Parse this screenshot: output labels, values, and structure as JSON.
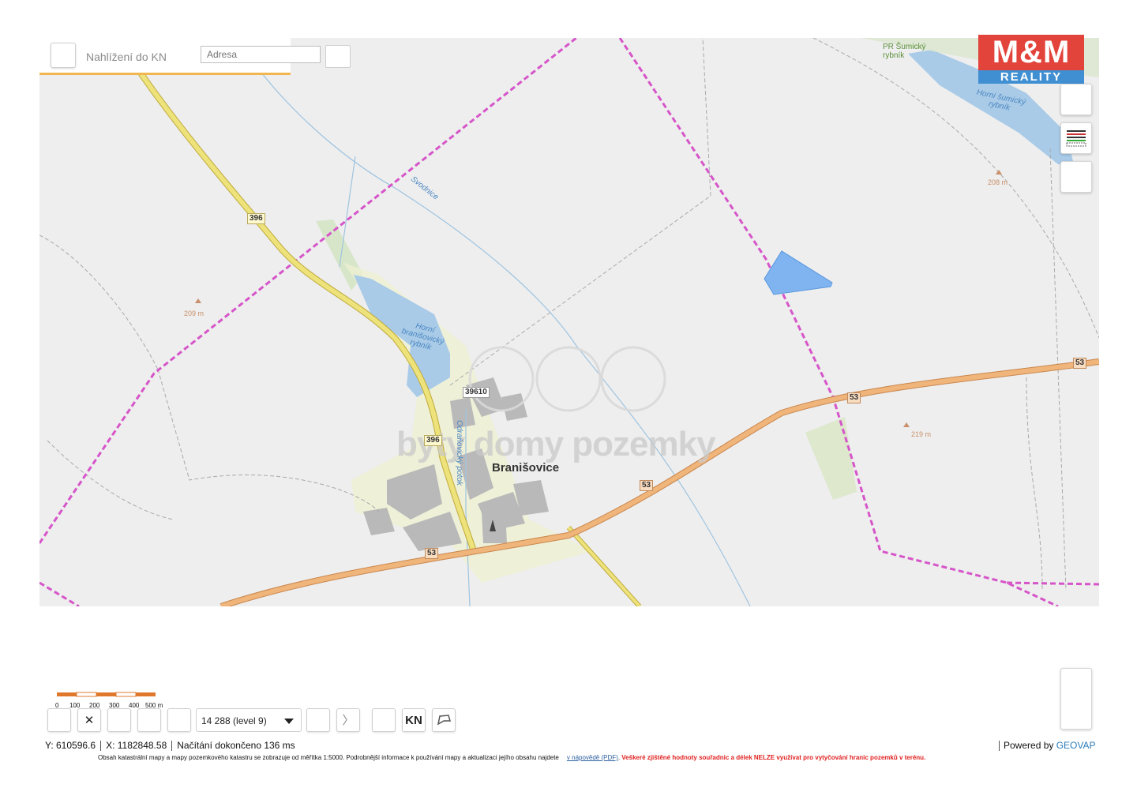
{
  "header": {
    "title": "Nahlížení do KN",
    "address_placeholder": "Adresa"
  },
  "logo": {
    "top": "M&M",
    "bottom": "REALITY"
  },
  "map_labels": {
    "town": "Branišovice",
    "pond_upper_left": [
      "Horní",
      "branišovický",
      "rybník"
    ],
    "pond_upper_right": [
      "Horní šumický",
      "rybník"
    ],
    "reserve": [
      "PR Šumický",
      "rybník"
    ],
    "stream1": "Svodnice",
    "stream2": "Odraňovický potok",
    "elev1": "209 m",
    "elev2": "208 m",
    "elev3": "219 m",
    "road396a": "396",
    "road396b": "396",
    "road39610": "39610",
    "road53a": "53",
    "road53b": "53",
    "road53c": "53",
    "road53d": "53",
    "watermark": "byty domy pozemky"
  },
  "scale": {
    "ticks": [
      "0",
      "100",
      "200",
      "300",
      "400",
      "500 m"
    ]
  },
  "toolbar": {
    "zoom_select": "14 288 (level 9)",
    "kn_label": "KN",
    "close_glyph": "✕",
    "next_glyph": "〉"
  },
  "status": {
    "y": "Y: 610596.6",
    "x": "X: 1182848.58",
    "load": "Načítání dokončeno 136 ms",
    "powered_prefix": "Powered by",
    "powered_brand": "GEOVAP"
  },
  "footer": {
    "text": "Obsah katastrální mapy a mapy pozemkového katastru se zobrazuje od měřítka 1:5000. Podrobnější informace k používání mapy a aktualizaci jejího obsahu najdete",
    "link": "v nápovědě (PDF)",
    "dot": ".",
    "warning": "Veškeré zjištěné hodnoty souřadnic a délek NELZE využívat pro vytyčování hranic pozemků v terénu."
  },
  "colors": {
    "map_bg": "#eeeeee",
    "cadastral_border": "#d655c9",
    "main_road": "#f0b57a",
    "secondary_road": "#ede37a",
    "water": "#a9cbe8",
    "parcel_highlight": "#7fb4f0",
    "accent": "#f1b650"
  }
}
